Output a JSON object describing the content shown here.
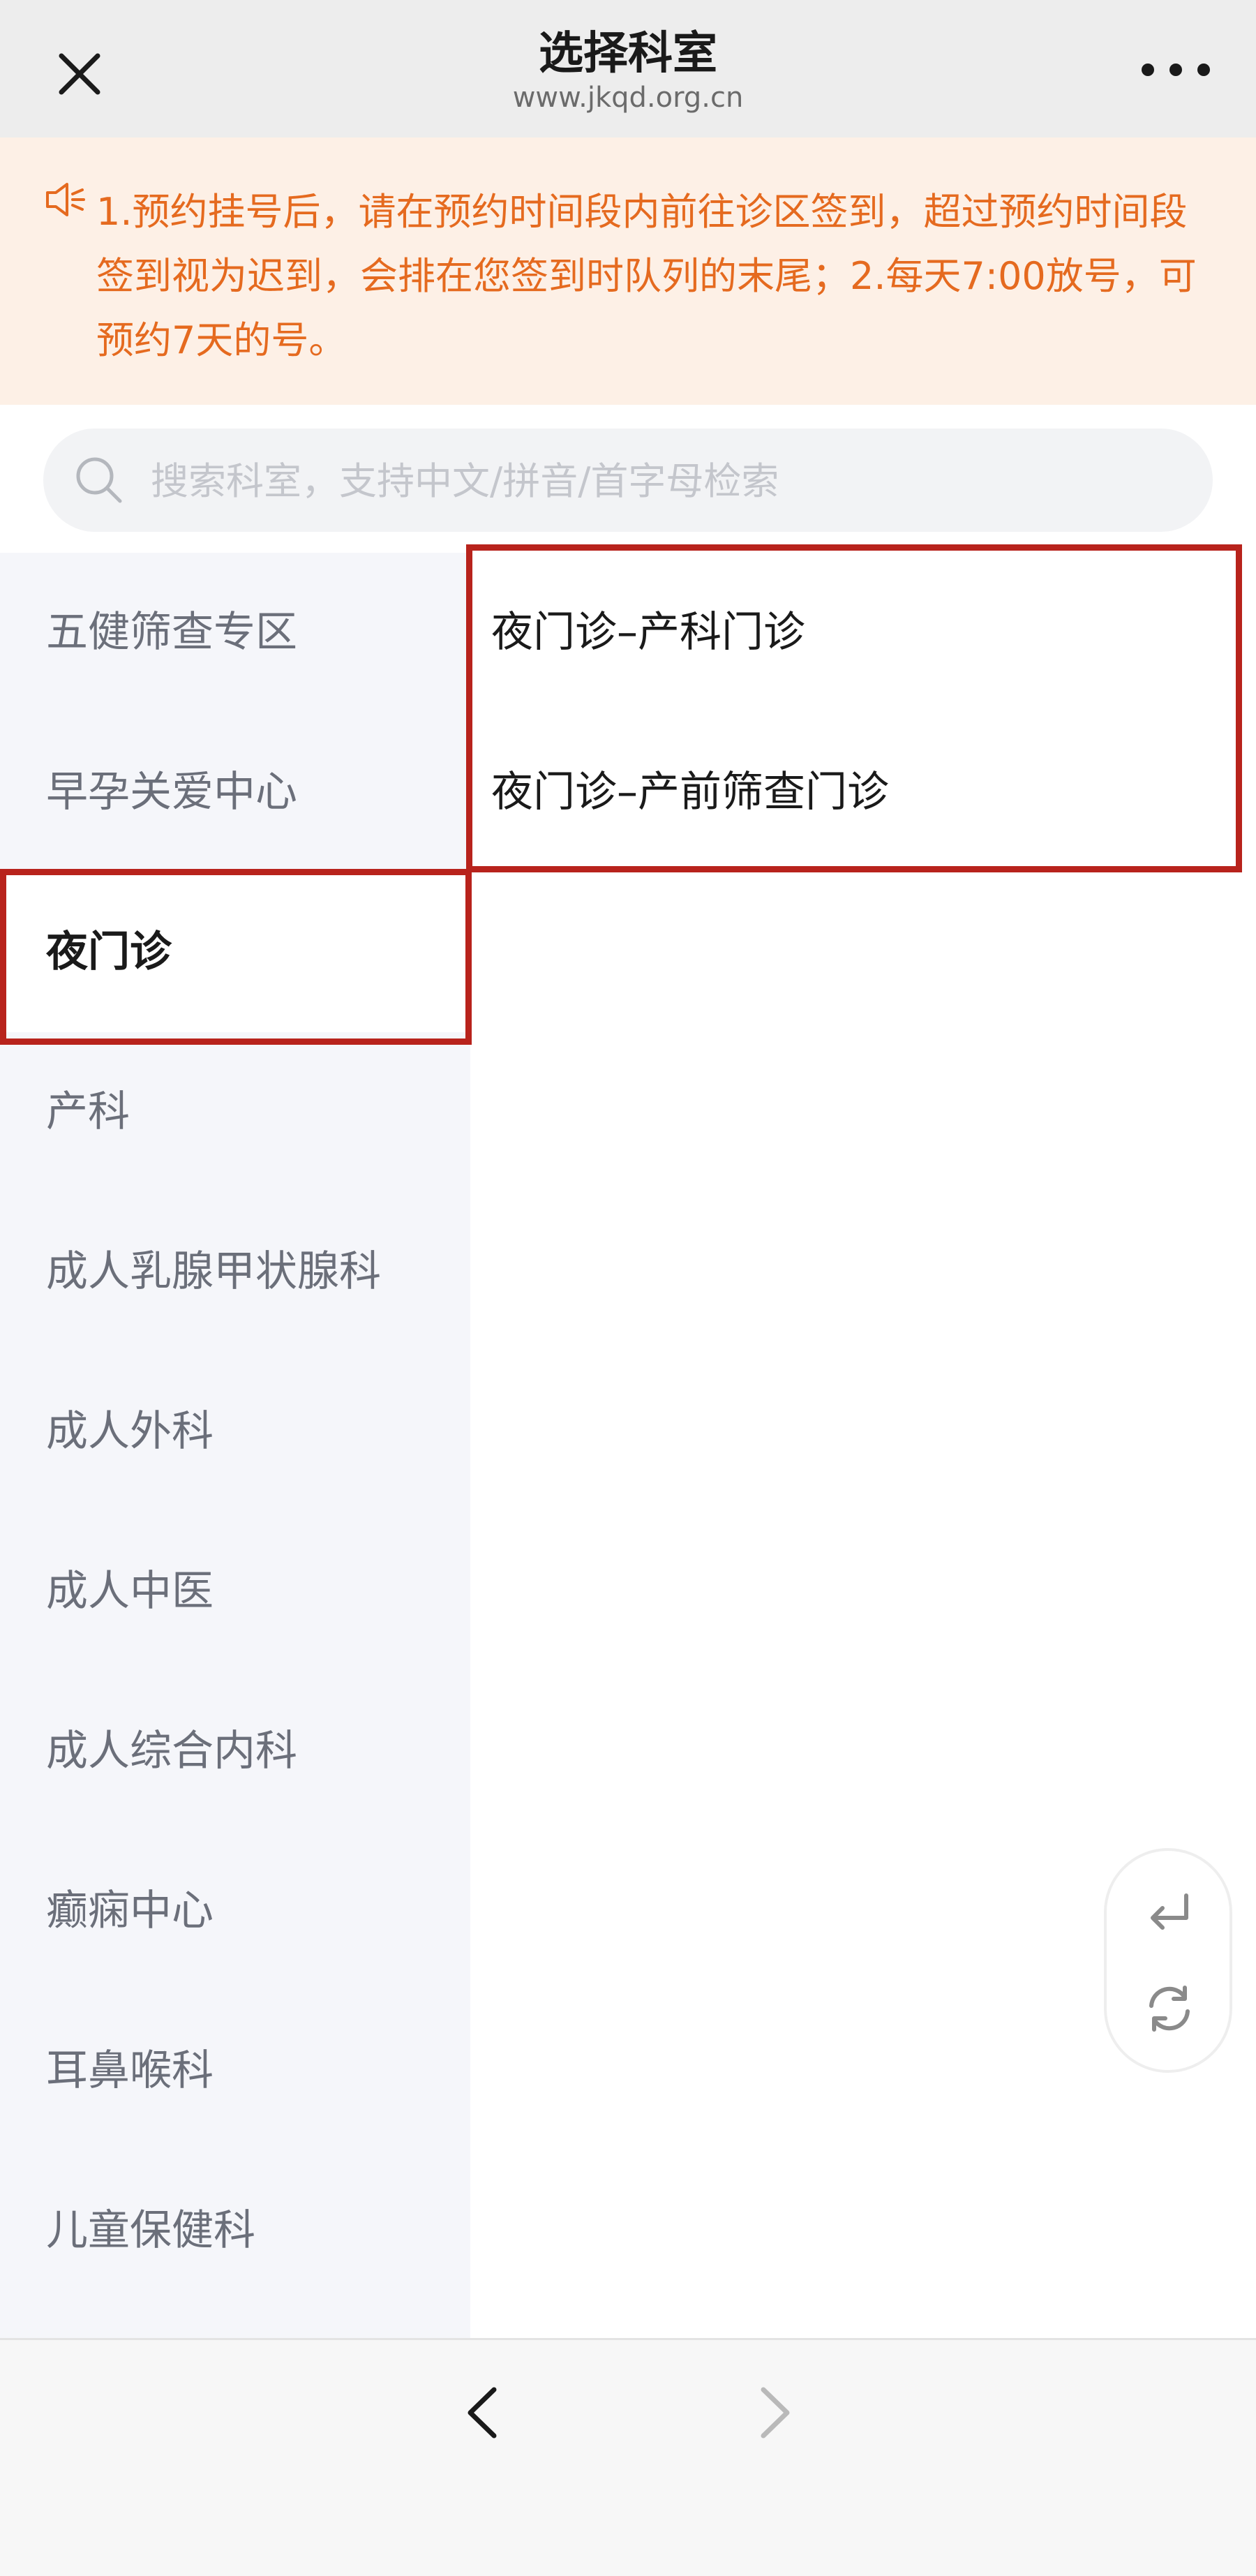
{
  "header": {
    "title": "选择科室",
    "domain": "www.jkqd.org.cn",
    "close_icon": "close-icon",
    "more_icon": "more-icon"
  },
  "notice": {
    "icon": "speaker-icon",
    "text": "1.预约挂号后，请在预约时间段内前往诊区签到，超过预约时间段签到视为迟到，会排在您签到时队列的末尾；2.每天7:00放号，可预约7天的号。"
  },
  "search": {
    "placeholder": "搜索科室，支持中文/拼音/首字母检索",
    "value": ""
  },
  "sidebar": {
    "items": [
      {
        "label": "五健筛查专区"
      },
      {
        "label": "早孕关爱中心"
      },
      {
        "label": "夜门诊"
      },
      {
        "label": "产科"
      },
      {
        "label": "成人乳腺甲状腺科"
      },
      {
        "label": "成人外科"
      },
      {
        "label": "成人中医"
      },
      {
        "label": "成人综合内科"
      },
      {
        "label": "癫痫中心"
      },
      {
        "label": "耳鼻喉科"
      },
      {
        "label": "儿童保健科"
      }
    ],
    "active_index": 2
  },
  "departments": {
    "items": [
      {
        "label": "夜门诊–产科门诊"
      },
      {
        "label": "夜门诊–产前筛查门诊"
      }
    ]
  },
  "float_actions": {
    "back_icon": "return-arrow-icon",
    "refresh_icon": "refresh-icon"
  },
  "bottom_nav": {
    "back_icon": "chevron-left-icon",
    "forward_icon": "chevron-right-icon"
  },
  "colors": {
    "accent_orange": "#e56a1f",
    "notice_bg": "#fdf0e6",
    "highlight_red": "#b8231c",
    "sidebar_bg": "#f5f6fa"
  }
}
